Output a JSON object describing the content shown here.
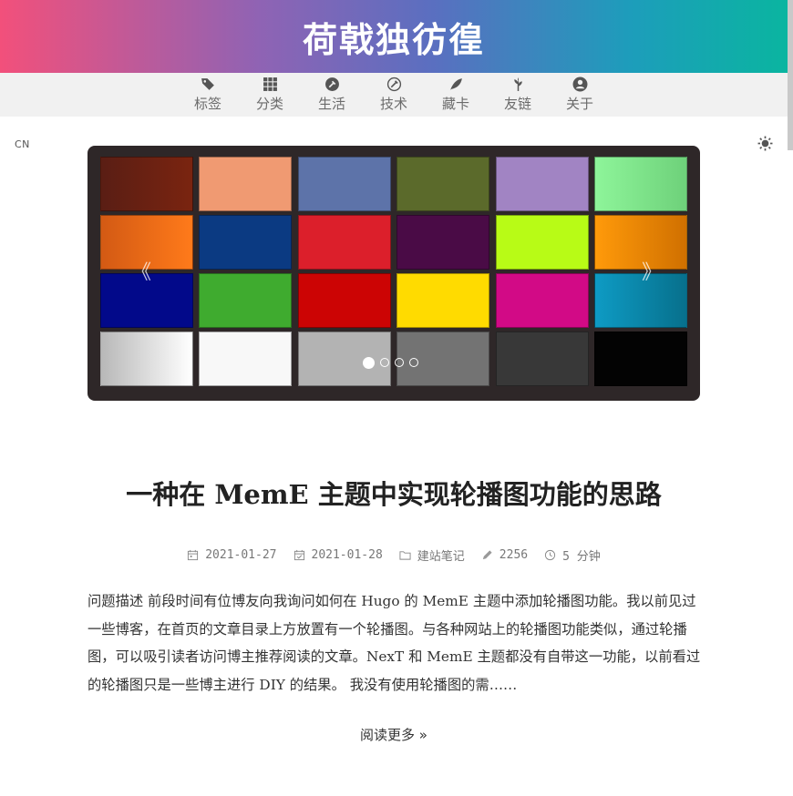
{
  "site": {
    "title": "荷戟独彷徨",
    "gradient_colors": [
      "#f2507b",
      "#8f63b4",
      "#5a6fc0",
      "#1d9dbb",
      "#0ab5a0"
    ]
  },
  "nav": {
    "items": [
      {
        "label": "标签",
        "icon": "tags-icon"
      },
      {
        "label": "分类",
        "icon": "grid-icon"
      },
      {
        "label": "生活",
        "icon": "hammer-icon"
      },
      {
        "label": "技术",
        "icon": "wrench-icon"
      },
      {
        "label": "藏卡",
        "icon": "feather-icon"
      },
      {
        "label": "友链",
        "icon": "sprout-icon"
      },
      {
        "label": "关于",
        "icon": "user-circle-icon"
      }
    ]
  },
  "toolbar": {
    "lang": "CN",
    "theme_icon": "sun-icon"
  },
  "carousel": {
    "prev": "《",
    "next": "》",
    "slide_count": 4,
    "active_slide": 1,
    "swatches": [
      [
        "#5a1e14",
        "#7a2410"
      ],
      [
        "#f09a72",
        "#f09a72"
      ],
      [
        "#5d73a9",
        "#5d73a9"
      ],
      [
        "#5b6a2b",
        "#5b6a2b"
      ],
      [
        "#a184c3",
        "#a184c3"
      ],
      [
        "#8ef59a",
        "#6ed17a"
      ],
      [
        "#d35a14",
        "#ff7a1a"
      ],
      [
        "#0b3a82",
        "#0b3a82"
      ],
      [
        "#dc1f2b",
        "#dc1f2b"
      ],
      [
        "#4a0b46",
        "#4a0b46"
      ],
      [
        "#b8fb16",
        "#b8fb16"
      ],
      [
        "#ff9a0a",
        "#d07000"
      ],
      [
        "#02098a",
        "#02098a"
      ],
      [
        "#3fab2f",
        "#3fab2f"
      ],
      [
        "#cc0404",
        "#cc0404"
      ],
      [
        "#ffdb00",
        "#ffdb00"
      ],
      [
        "#d20a86",
        "#d20a86"
      ],
      [
        "#0e9bc4",
        "#07708c"
      ],
      [
        "#b8b8b8",
        "#ffffff"
      ],
      [
        "#f8f8f8",
        "#f8f8f8"
      ],
      [
        "#b3b3b3",
        "#b3b3b3"
      ],
      [
        "#737373",
        "#737373"
      ],
      [
        "#383838",
        "#383838"
      ],
      [
        "#030303",
        "#030303"
      ]
    ]
  },
  "post": {
    "title": "一种在 MemE 主题中实现轮播图功能的思路",
    "published": "2021-01-27",
    "updated": "2021-01-28",
    "category": "建站笔记",
    "word_count": "2256",
    "reading_time": "5 分钟",
    "excerpt": "问题描述 前段时间有位博友向我询问如何在 Hugo 的 MemE 主题中添加轮播图功能。我以前见过一些博客，在首页的文章目录上方放置有一个轮播图。与各种网站上的轮播图功能类似，通过轮播图，可以吸引读者访问博主推荐阅读的文章。NexT 和 MemE 主题都没有自带这一功能，以前看过的轮播图只是一些博主进行 DIY 的结果。 我没有使用轮播图的需……",
    "read_more": "阅读更多 »"
  }
}
